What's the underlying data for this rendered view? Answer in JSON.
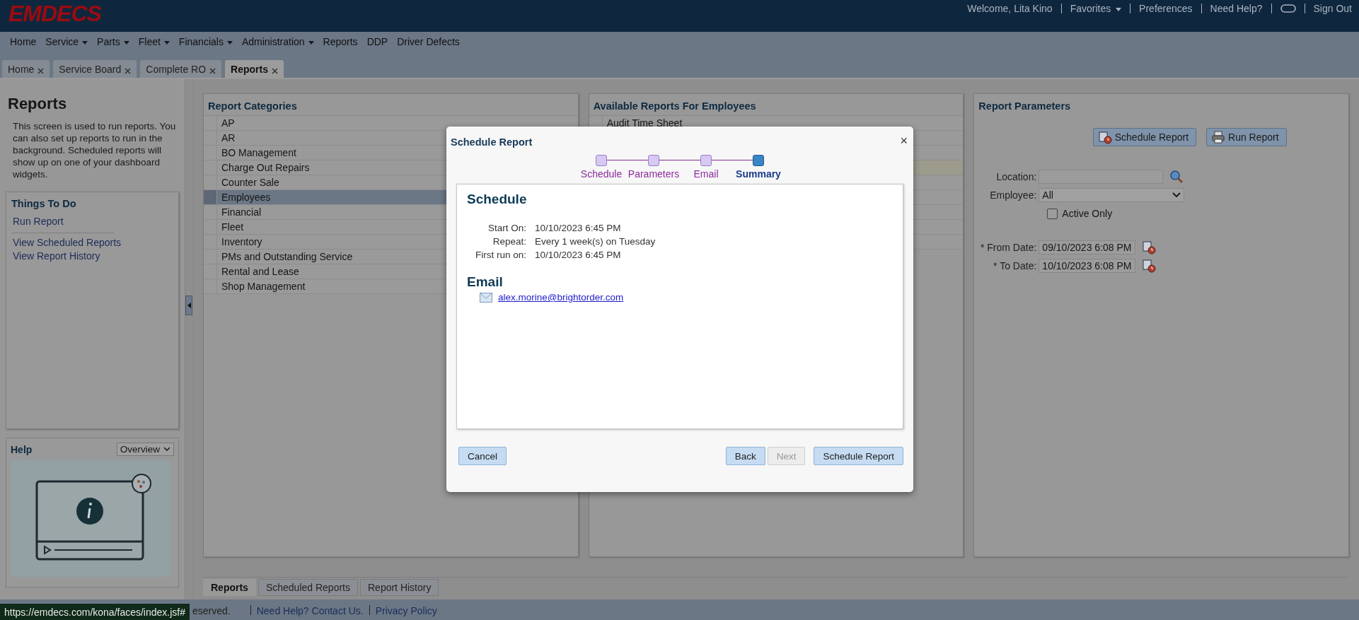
{
  "header": {
    "logo": "EMDECS",
    "welcome": "Welcome, Lita Kino",
    "favorites": "Favorites",
    "preferences": "Preferences",
    "need_help": "Need Help?",
    "sign_out": "Sign Out"
  },
  "menu": [
    {
      "label": "Home",
      "dropdown": false
    },
    {
      "label": "Service",
      "dropdown": true
    },
    {
      "label": "Parts",
      "dropdown": true
    },
    {
      "label": "Fleet",
      "dropdown": true
    },
    {
      "label": "Financials",
      "dropdown": true
    },
    {
      "label": "Administration",
      "dropdown": true
    },
    {
      "label": "Reports",
      "dropdown": false
    },
    {
      "label": "DDP",
      "dropdown": false
    },
    {
      "label": "Driver Defects",
      "dropdown": false
    }
  ],
  "tabs": [
    {
      "label": "Home",
      "selected": false
    },
    {
      "label": "Service Board",
      "selected": false
    },
    {
      "label": "Complete RO",
      "selected": false
    },
    {
      "label": "Reports",
      "selected": true
    }
  ],
  "sidebar": {
    "title": "Reports",
    "description": "This screen is used to run reports. You can also set up reports to run in the background. Scheduled reports will show up on one of your dashboard widgets.",
    "todo_title": "Things To Do",
    "todo_links": [
      "Run Report",
      "View Scheduled Reports",
      "View Report History"
    ],
    "help_title": "Help",
    "help_select": "Overview"
  },
  "categories": {
    "title": "Report Categories",
    "items": [
      {
        "label": "AP",
        "selected": false
      },
      {
        "label": "AR",
        "selected": false
      },
      {
        "label": "BO Management",
        "selected": false
      },
      {
        "label": "Charge Out Repairs",
        "selected": false
      },
      {
        "label": "Counter Sale",
        "selected": false
      },
      {
        "label": "Employees",
        "selected": true
      },
      {
        "label": "Financial",
        "selected": false
      },
      {
        "label": "Fleet",
        "selected": false
      },
      {
        "label": "Inventory",
        "selected": false
      },
      {
        "label": "PMs and Outstanding Service",
        "selected": false
      },
      {
        "label": "Rental and Lease",
        "selected": false
      },
      {
        "label": "Shop Management",
        "selected": false
      }
    ]
  },
  "available": {
    "title": "Available Reports For Employees",
    "items": [
      "Audit Time Sheet"
    ]
  },
  "parameters": {
    "title": "Report Parameters",
    "buttons": [
      {
        "label": "Schedule Report",
        "kind": "schedule"
      },
      {
        "label": "Run Report",
        "kind": "print"
      }
    ],
    "fields": [
      {
        "kind": "search",
        "label": "Location:"
      },
      {
        "kind": "select",
        "label": "Employee:",
        "value": "All"
      },
      {
        "kind": "checkbox",
        "label": "Active Only",
        "checked": false
      },
      {
        "kind": "date",
        "label": "* From Date:",
        "value": "09/10/2023 6:08 PM"
      },
      {
        "kind": "date",
        "label": "* To Date:",
        "value": "10/10/2023 6:08 PM"
      }
    ]
  },
  "bottom_tabs": [
    {
      "label": "Reports",
      "selected": true
    },
    {
      "label": "Scheduled Reports",
      "selected": false
    },
    {
      "label": "Report History",
      "selected": false
    }
  ],
  "footer": {
    "status_url": "https://emdecs.com/kona/faces/index.jsf#",
    "text": "eserved.",
    "links": [
      "Need Help? Contact Us.",
      "Privacy Policy"
    ]
  },
  "dialog": {
    "title": "Schedule Report",
    "close": "×",
    "steps": [
      {
        "label": "Schedule",
        "selected": false
      },
      {
        "label": "Parameters",
        "selected": false
      },
      {
        "label": "Email",
        "selected": false
      },
      {
        "label": "Summary",
        "selected": true
      }
    ],
    "schedule_heading": "Schedule",
    "rows": [
      {
        "label": "Start On:",
        "value": "10/10/2023 6:45 PM"
      },
      {
        "label": "Repeat:",
        "value": "Every 1 week(s) on Tuesday"
      },
      {
        "label": "First run on:",
        "value": "10/10/2023 6:45 PM"
      }
    ],
    "email_heading": "Email",
    "email": "alex.morine@brightorder.com",
    "cancel": "Cancel",
    "buttons": [
      {
        "label": "Back",
        "disabled": false
      },
      {
        "label": "Next",
        "disabled": true
      },
      {
        "label": "Schedule Report",
        "disabled": false
      }
    ]
  }
}
